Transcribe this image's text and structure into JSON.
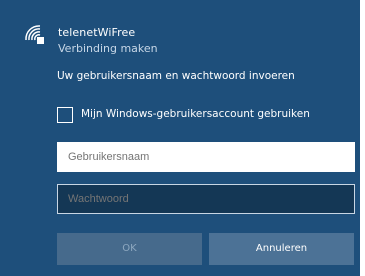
{
  "network": {
    "ssid": "telenetWiFree",
    "status": "Verbinding maken",
    "icon": "wifi-secured-icon"
  },
  "form": {
    "prompt": "Uw gebruikersnaam en wachtwoord invoeren",
    "checkbox_label": "Mijn Windows-gebruikersaccount gebruiken",
    "checkbox_checked": false,
    "username_placeholder": "Gebruikersnaam",
    "username_value": "",
    "password_placeholder": "Wachtwoord",
    "password_value": ""
  },
  "buttons": {
    "ok": "OK",
    "cancel": "Annuleren"
  },
  "colors": {
    "panel_bg": "#1e4f7b",
    "field_dark": "#143755",
    "button_bg": "#4c7296"
  }
}
